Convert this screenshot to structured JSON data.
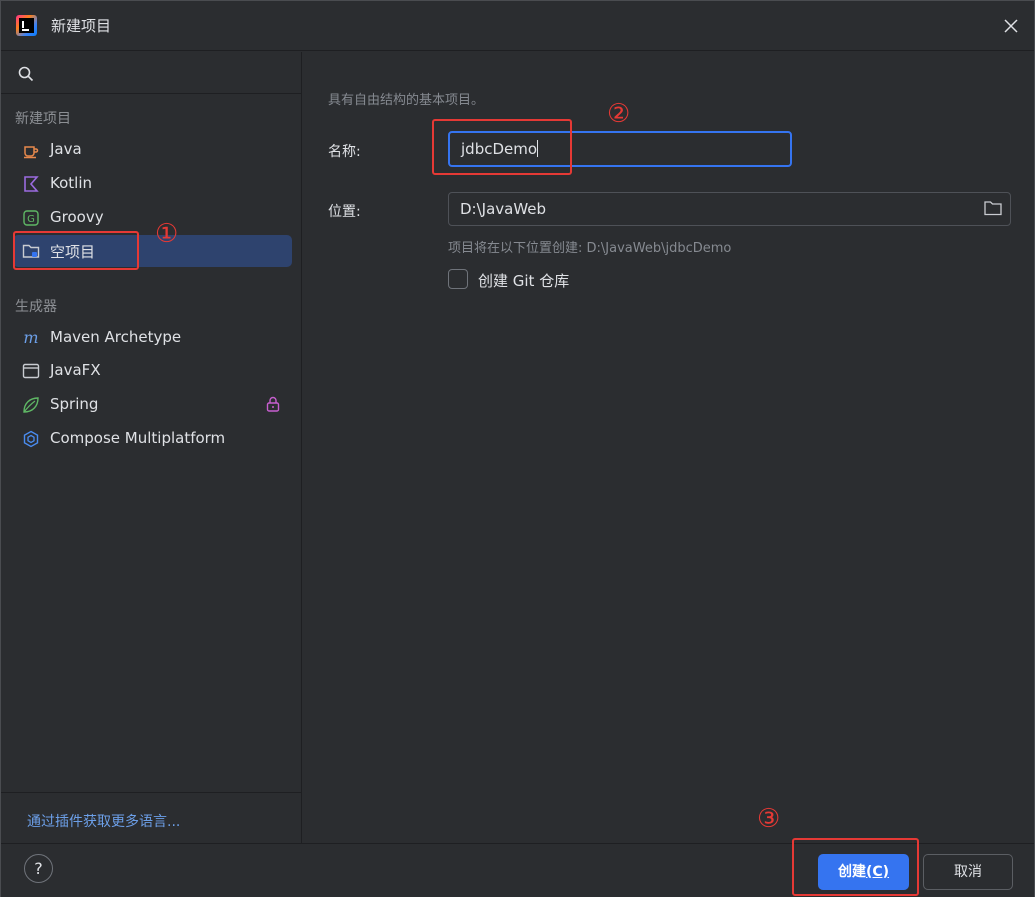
{
  "window": {
    "title": "新建项目",
    "icon": "intellij-idea-logo"
  },
  "sidebar": {
    "search": {
      "placeholder": "",
      "value": ""
    },
    "sections": [
      {
        "header": "新建项目",
        "items": [
          {
            "label": "Java",
            "icon": "java-cup-icon",
            "selected": false
          },
          {
            "label": "Kotlin",
            "icon": "kotlin-icon",
            "selected": false
          },
          {
            "label": "Groovy",
            "icon": "groovy-icon",
            "selected": false
          },
          {
            "label": "空项目",
            "icon": "empty-folder-icon",
            "selected": true
          }
        ]
      },
      {
        "header": "生成器",
        "items": [
          {
            "label": "Maven Archetype",
            "icon": "maven-icon",
            "selected": false
          },
          {
            "label": "JavaFX",
            "icon": "javafx-window-icon",
            "selected": false
          },
          {
            "label": "Spring",
            "icon": "spring-leaf-icon",
            "selected": false,
            "locked": true
          },
          {
            "label": "Compose Multiplatform",
            "icon": "compose-icon",
            "selected": false
          }
        ]
      }
    ],
    "footer_link": "通过插件获取更多语言..."
  },
  "main": {
    "description": "具有自由结构的基本项目。",
    "name_label": "名称:",
    "name_value": "jdbcDemo",
    "location_label": "位置:",
    "location_value": "D:\\JavaWeb",
    "location_hint": "项目将在以下位置创建: D:\\JavaWeb\\jdbcDemo",
    "git_checkbox_label": "创建 Git 仓库",
    "git_checked": false
  },
  "footer": {
    "help_label": "?",
    "create_label": "创建",
    "create_mnemonic": "(C)",
    "cancel_label": "取消"
  },
  "annotations": [
    "①",
    "②",
    "③"
  ],
  "colors": {
    "background": "#2b2d30",
    "accent": "#3574f0",
    "selection": "#2e436e",
    "annotation": "#e53935",
    "link": "#6c9fe8"
  }
}
